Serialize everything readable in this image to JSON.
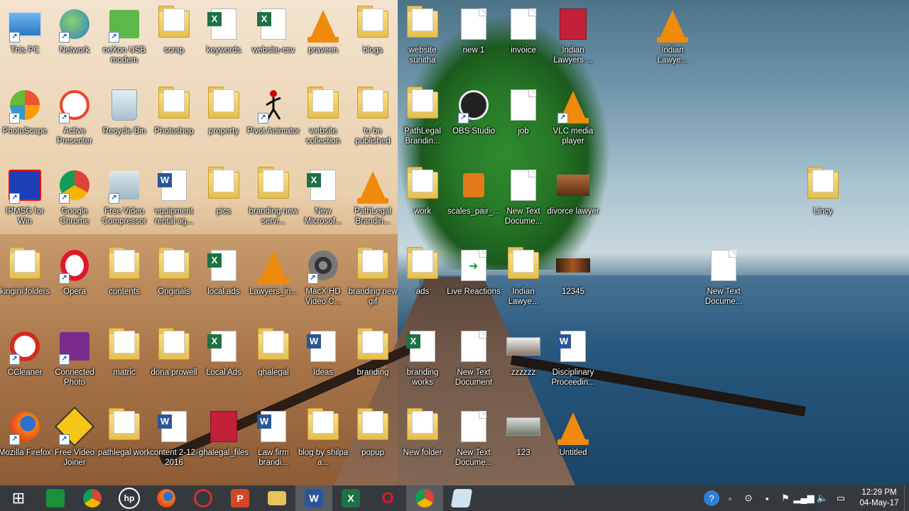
{
  "desktop_icons": [
    {
      "label": "This PC"
    },
    {
      "label": "Network"
    },
    {
      "label": "neXon USB modem"
    },
    {
      "label": "scrap"
    },
    {
      "label": "keywords"
    },
    {
      "label": "website-csv"
    },
    {
      "label": "praveen"
    },
    {
      "label": "blogs"
    },
    {
      "label": "website sunitha"
    },
    {
      "label": "new 1"
    },
    {
      "label": "invoice"
    },
    {
      "label": "Indian Lawyers ..."
    },
    {
      "label": "Indian Lawye..."
    },
    {
      "label": "PhotoScape"
    },
    {
      "label": "Active Presenter"
    },
    {
      "label": "Recycle Bin"
    },
    {
      "label": "Photoshop"
    },
    {
      "label": "property"
    },
    {
      "label": "Pivot Animator"
    },
    {
      "label": "website collection"
    },
    {
      "label": "to be published"
    },
    {
      "label": "PathLegal Brandin..."
    },
    {
      "label": "OBS Studio"
    },
    {
      "label": "job"
    },
    {
      "label": "VLC media player"
    },
    {
      "label": "IPMSG for Win"
    },
    {
      "label": "Google Chrome"
    },
    {
      "label": "Free Video Compressor"
    },
    {
      "label": "equipment rental ag..."
    },
    {
      "label": "pics"
    },
    {
      "label": "branding new servi..."
    },
    {
      "label": "New Microsof..."
    },
    {
      "label": "PathLegal Brandin..."
    },
    {
      "label": "work"
    },
    {
      "label": "scales_pair_..."
    },
    {
      "label": "New Text Docume..."
    },
    {
      "label": "divorce lawyer"
    },
    {
      "label": "Lincy"
    },
    {
      "label": "kingini folders"
    },
    {
      "label": "Opera"
    },
    {
      "label": "contents"
    },
    {
      "label": "Originals"
    },
    {
      "label": "local ads"
    },
    {
      "label": "Lawyers_in..."
    },
    {
      "label": "MacX HD Video C..."
    },
    {
      "label": "branding new gif"
    },
    {
      "label": "ads"
    },
    {
      "label": "Live Reactions"
    },
    {
      "label": "Indian Lawye..."
    },
    {
      "label": "12345"
    },
    {
      "label": "New Text Docume..."
    },
    {
      "label": "CCleaner"
    },
    {
      "label": "Connected Photo"
    },
    {
      "label": "matric"
    },
    {
      "label": "dona prowell"
    },
    {
      "label": "Local Ads"
    },
    {
      "label": "ghalegal"
    },
    {
      "label": "Ideas"
    },
    {
      "label": "branding"
    },
    {
      "label": "branding works"
    },
    {
      "label": "New Text Document"
    },
    {
      "label": "zzzzzz"
    },
    {
      "label": "Disciplinary Proceedin..."
    },
    {
      "label": "Mozilla Firefox"
    },
    {
      "label": "Free Video Joiner"
    },
    {
      "label": "pathlegal work"
    },
    {
      "label": "content 2-12-2016"
    },
    {
      "label": "ghalegal_files"
    },
    {
      "label": "Law firm brandi..."
    },
    {
      "label": "blog by shilpa a..."
    },
    {
      "label": "popup"
    },
    {
      "label": "New folder"
    },
    {
      "label": "New Text Docume..."
    },
    {
      "label": "123"
    },
    {
      "label": "Untitled"
    }
  ],
  "taskbar": {
    "items": [
      {
        "name": "Start",
        "glyph": "⊞"
      },
      {
        "name": "Store",
        "glyph": "🛍"
      },
      {
        "name": "Google Chrome",
        "glyph": ""
      },
      {
        "name": "HP",
        "glyph": "hp"
      },
      {
        "name": "Firefox",
        "glyph": ""
      },
      {
        "name": "Recorder",
        "glyph": ""
      },
      {
        "name": "PowerPoint",
        "glyph": "P"
      },
      {
        "name": "File Explorer",
        "glyph": ""
      },
      {
        "name": "Word",
        "glyph": "W"
      },
      {
        "name": "Excel",
        "glyph": "X"
      },
      {
        "name": "Opera",
        "glyph": "O"
      },
      {
        "name": "Google Chrome",
        "glyph": ""
      },
      {
        "name": "Notepad",
        "glyph": ""
      }
    ],
    "clock": {
      "time": "12:29 PM",
      "date": "04-May-17"
    }
  }
}
